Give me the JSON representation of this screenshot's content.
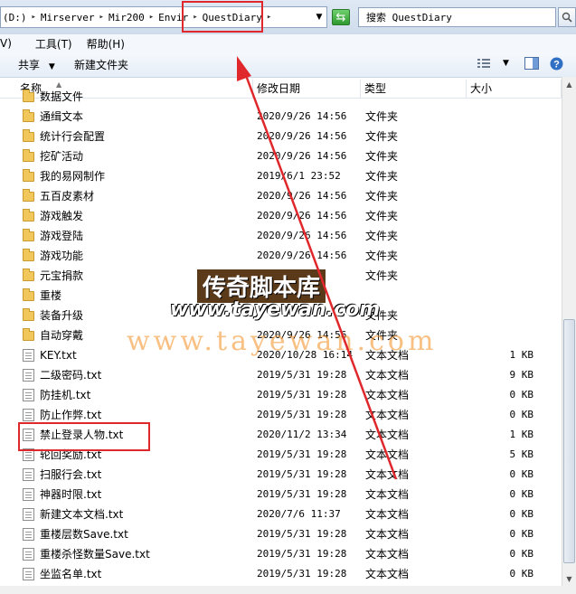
{
  "address": {
    "crumbs": [
      "(D:)",
      "Mirserver",
      "Mir200",
      "Envir",
      "QuestDiary"
    ],
    "separator": "▸"
  },
  "search": {
    "placeholder": "搜索 QuestDiary"
  },
  "menu": {
    "items": [
      "V)",
      "工具(T)",
      "帮助(H)"
    ]
  },
  "toolbar": {
    "share_label": "共享",
    "new_folder_label": "新建文件夹"
  },
  "columns": {
    "name": "名称",
    "date": "修改日期",
    "type": "类型",
    "size": "大小"
  },
  "files": [
    {
      "name": "数据文件",
      "date": "",
      "type": "",
      "size": "",
      "kind": "folder"
    },
    {
      "name": "通缉文本",
      "date": "2020/9/26 14:56",
      "type": "文件夹",
      "size": "",
      "kind": "folder"
    },
    {
      "name": "统计行会配置",
      "date": "2020/9/26 14:56",
      "type": "文件夹",
      "size": "",
      "kind": "folder"
    },
    {
      "name": "挖矿活动",
      "date": "2020/9/26 14:56",
      "type": "文件夹",
      "size": "",
      "kind": "folder"
    },
    {
      "name": "我的易网制作",
      "date": "2019/6/1 23:52",
      "type": "文件夹",
      "size": "",
      "kind": "folder"
    },
    {
      "name": "五百皮素材",
      "date": "2020/9/26 14:56",
      "type": "文件夹",
      "size": "",
      "kind": "folder"
    },
    {
      "name": "游戏触发",
      "date": "2020/9/26 14:56",
      "type": "文件夹",
      "size": "",
      "kind": "folder"
    },
    {
      "name": "游戏登陆",
      "date": "2020/9/26 14:56",
      "type": "文件夹",
      "size": "",
      "kind": "folder"
    },
    {
      "name": "游戏功能",
      "date": "2020/9/26 14:56",
      "type": "文件夹",
      "size": "",
      "kind": "folder"
    },
    {
      "name": "元宝捐款",
      "date": "",
      "type": "文件夹",
      "size": "",
      "kind": "folder"
    },
    {
      "name": "重楼",
      "date": "",
      "type": "",
      "size": "",
      "kind": "folder"
    },
    {
      "name": "装备升级",
      "date": "",
      "type": "文件夹",
      "size": "",
      "kind": "folder"
    },
    {
      "name": "自动穿戴",
      "date": "2020/9/26 14:56",
      "type": "文件夹",
      "size": "",
      "kind": "folder"
    },
    {
      "name": "KEY.txt",
      "date": "2020/10/28 16:14",
      "type": "文本文档",
      "size": "1 KB",
      "kind": "file"
    },
    {
      "name": "二级密码.txt",
      "date": "2019/5/31 19:28",
      "type": "文本文档",
      "size": "9 KB",
      "kind": "file"
    },
    {
      "name": "防挂机.txt",
      "date": "2019/5/31 19:28",
      "type": "文本文档",
      "size": "0 KB",
      "kind": "file"
    },
    {
      "name": "防止作弊.txt",
      "date": "2019/5/31 19:28",
      "type": "文本文档",
      "size": "0 KB",
      "kind": "file"
    },
    {
      "name": "禁止登录人物.txt",
      "date": "2020/11/2 13:34",
      "type": "文本文档",
      "size": "1 KB",
      "kind": "file"
    },
    {
      "name": "轮回奖励.txt",
      "date": "2019/5/31 19:28",
      "type": "文本文档",
      "size": "5 KB",
      "kind": "file"
    },
    {
      "name": "扫服行会.txt",
      "date": "2019/5/31 19:28",
      "type": "文本文档",
      "size": "0 KB",
      "kind": "file"
    },
    {
      "name": "神器时限.txt",
      "date": "2019/5/31 19:28",
      "type": "文本文档",
      "size": "0 KB",
      "kind": "file"
    },
    {
      "name": "新建文本文档.txt",
      "date": "2020/7/6 11:37",
      "type": "文本文档",
      "size": "0 KB",
      "kind": "file"
    },
    {
      "name": "重楼层数Save.txt",
      "date": "2019/5/31 19:28",
      "type": "文本文档",
      "size": "0 KB",
      "kind": "file"
    },
    {
      "name": "重楼杀怪数量Save.txt",
      "date": "2019/5/31 19:28",
      "type": "文本文档",
      "size": "0 KB",
      "kind": "file"
    },
    {
      "name": "坐监名单.txt",
      "date": "2019/5/31 19:28",
      "type": "文本文档",
      "size": "0 KB",
      "kind": "file"
    }
  ],
  "watermark": {
    "title": "传奇脚本库",
    "url": "www.tayewan.com",
    "url_large": "www.tayewan.com"
  },
  "annotation_color": "#e0282c"
}
